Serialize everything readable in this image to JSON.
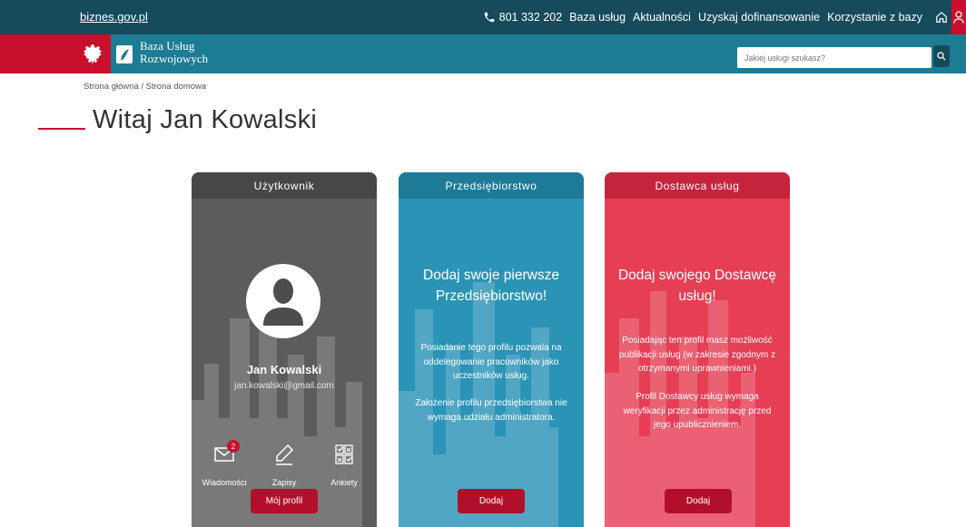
{
  "topbar": {
    "domain": "biznes.gov.pl",
    "phone": "801 332 202",
    "links": [
      "Baza usług",
      "Aktualności",
      "Uzyskaj dofinansowanie",
      "Korzystanie z bazy"
    ],
    "colors": {
      "background": "#164b5c",
      "accent": "#c8102e"
    },
    "icons": [
      "phone-icon",
      "home-icon",
      "user-icon"
    ]
  },
  "brand": {
    "line1": "Baza Usług",
    "line2": "Rozwojowych",
    "colors": {
      "background": "#1d7b93",
      "flag_red": "#c8102e"
    }
  },
  "search": {
    "placeholder": "Jakiej usługi szukasz?"
  },
  "breadcrumb": "Strona główna / Strona domowa",
  "page_title": "Witaj Jan Kowalski",
  "cards": {
    "user": {
      "title": "Użytkownik",
      "name": "Jan Kowalski",
      "email": "jan.kowalski@gmail.com",
      "messages_badge": "2",
      "actions": [
        "Wiadomości",
        "Zapisy",
        "Ankiety"
      ],
      "button": "Mój profil",
      "color": "#5c5c5c"
    },
    "enterprise": {
      "title": "Przedsiębiorstwo",
      "headline": "Dodaj swoje pierwsze Przedsiębiorstwo!",
      "paragraph1": "Posiadanie tego profilu pozwala na oddelegowanie pracowników jako uczestników usług.",
      "paragraph2": "Założenie profilu przedsiębiorstwa nie wymaga udziału administratora.",
      "button": "Dodaj",
      "color": "#2b93b6"
    },
    "provider": {
      "title": "Dostawca usług",
      "headline": "Dodaj swojego Dostawcę usług!",
      "paragraph1": "Posiadając ten profil masz możliwość publikacji usług (w zakresie zgodnym z otrzymanymi uprawnieniami.)",
      "paragraph2": "Profil Dostawcy usług wymaga weryfikacji przez administrację przed jego upublicznieniem.",
      "button": "Dodaj",
      "color": "#e63e54"
    }
  }
}
